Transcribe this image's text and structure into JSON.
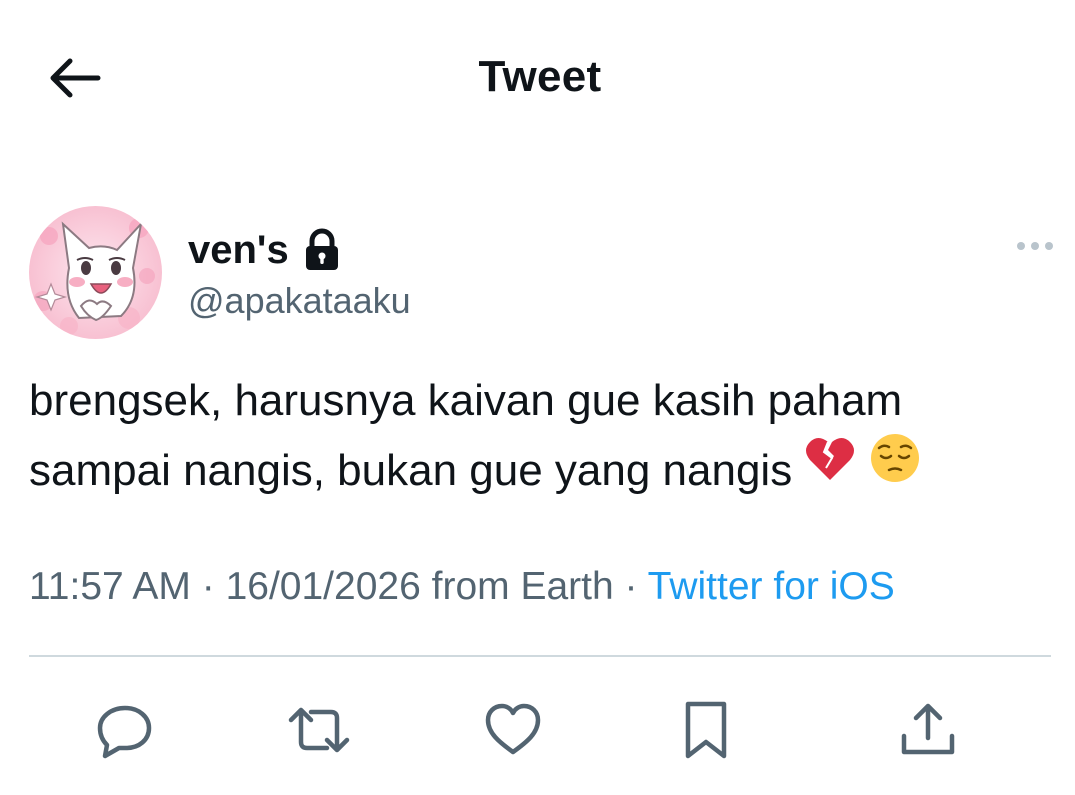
{
  "header": {
    "title": "Tweet",
    "back_icon": "arrow-left-icon"
  },
  "tweet": {
    "author": {
      "display_name": "ven's",
      "handle": "@apakataaku",
      "protected_icon": "lock-icon",
      "avatar": "cat-avatar-pink-background"
    },
    "text_line1": "brengsek, harusnya kaivan gue kasih paham",
    "text_line2": "sampai nangis, bukan gue yang nangis",
    "emojis": [
      "broken-heart-emoji",
      "pensive-face-emoji"
    ],
    "time": "11:57 AM",
    "date": "16/01/2026",
    "location": "from Earth",
    "separator": "·",
    "source": "Twitter for iOS"
  },
  "actions": [
    {
      "name": "reply",
      "icon": "reply-icon"
    },
    {
      "name": "retweet",
      "icon": "retweet-icon"
    },
    {
      "name": "like",
      "icon": "heart-icon"
    },
    {
      "name": "bookmark",
      "icon": "bookmark-icon"
    },
    {
      "name": "share",
      "icon": "share-icon"
    }
  ],
  "colors": {
    "text": "#0f1419",
    "secondary": "#536471",
    "link": "#1d9bf0",
    "divider": "#cfd9de",
    "icon": "#536471"
  }
}
